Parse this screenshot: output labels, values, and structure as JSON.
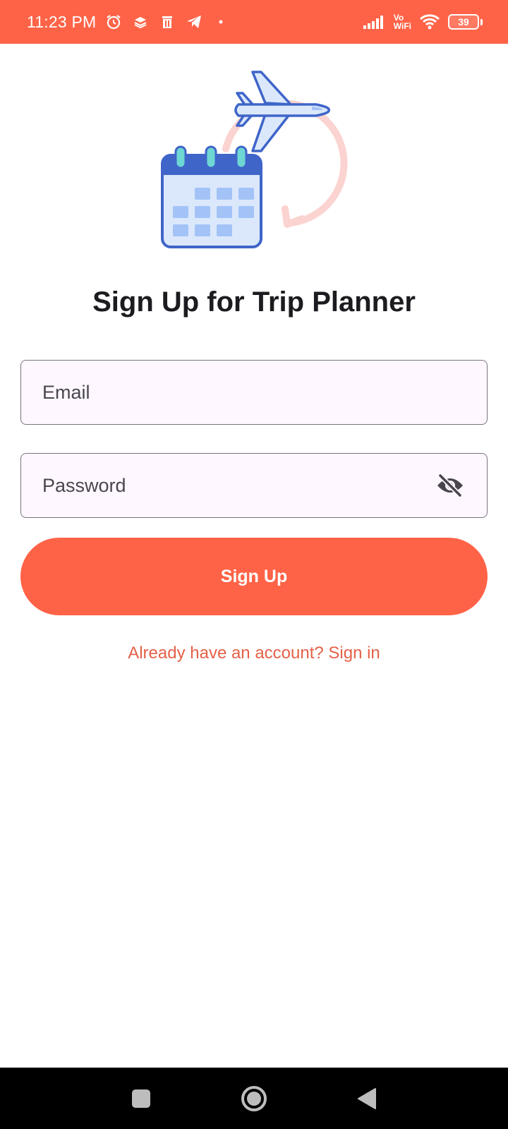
{
  "status_bar": {
    "time": "11:23 PM",
    "left_icons": [
      "alarm-icon",
      "layers-icon",
      "trash-icon",
      "telegram-icon",
      "dot-icon"
    ],
    "vowifi_top": "Vo",
    "vowifi_bottom": "WiFi",
    "battery": "39",
    "background": "#ff6347"
  },
  "signup": {
    "title": "Sign Up for Trip Planner",
    "email": {
      "placeholder": "Email",
      "value": ""
    },
    "password": {
      "placeholder": "Password",
      "value": "",
      "toggle_icon": "eye-off-icon"
    },
    "button_label": "Sign Up",
    "signin_link": "Already have an account? Sign in"
  },
  "nav_bar": {
    "items": [
      "recents-square-icon",
      "home-circle-icon",
      "back-triangle-icon"
    ]
  },
  "colors": {
    "accent": "#ff6347",
    "link": "#e46148",
    "field_bg": "#fef7ff",
    "field_border": "#79747e"
  }
}
